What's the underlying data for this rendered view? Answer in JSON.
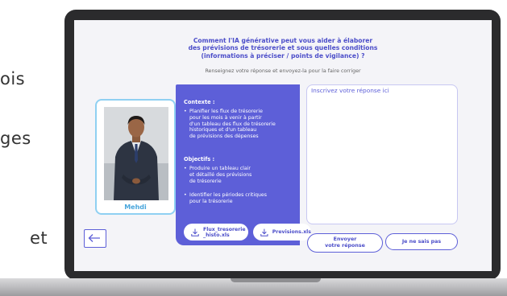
{
  "background_words": [
    "ois",
    "ges",
    "et"
  ],
  "screen": {
    "question": {
      "line1": "Comment l'IA générative peut vous aider à élaborer",
      "line2": "des prévisions de trésorerie et sous quelles conditions",
      "line3": "(informations à préciser / points de vigilance) ?"
    },
    "instruction": "Renseignez votre réponse et envoyez-la pour la faire corriger",
    "avatar": {
      "name": "Mehdi"
    },
    "context": {
      "heading": "Contexte :",
      "bullet1": [
        "Planifier les flux de trésorerie",
        "pour les mois à venir à partir",
        "d'un tableau des flux de trésorerie",
        "historiques et d'un tableau",
        "de prévisions des dépenses"
      ]
    },
    "objectives": {
      "heading": "Objectifs :",
      "bullet1": [
        "Produire un tableau clair",
        "et détaillé des prévisions",
        "de trésorerie"
      ],
      "bullet2": [
        "Identifier les périodes critiques",
        "pour la trésorerie"
      ]
    },
    "files": [
      {
        "line1": "Flux_tresorerie",
        "line2": "_histo.xls",
        "icon": "download-icon"
      },
      {
        "line1": "Previsions.xls",
        "icon": "download-icon"
      }
    ],
    "answer_placeholder": "Inscrivez votre réponse ici",
    "send_button": {
      "line1": "Envoyer",
      "line2": "votre réponse"
    },
    "dont_know_button": "Je ne sais pas",
    "back_icon": "arrow-left-icon"
  },
  "colors": {
    "accent": "#5d5fd8",
    "title": "#4b4dc9",
    "avatar_name": "#49a6dc"
  }
}
